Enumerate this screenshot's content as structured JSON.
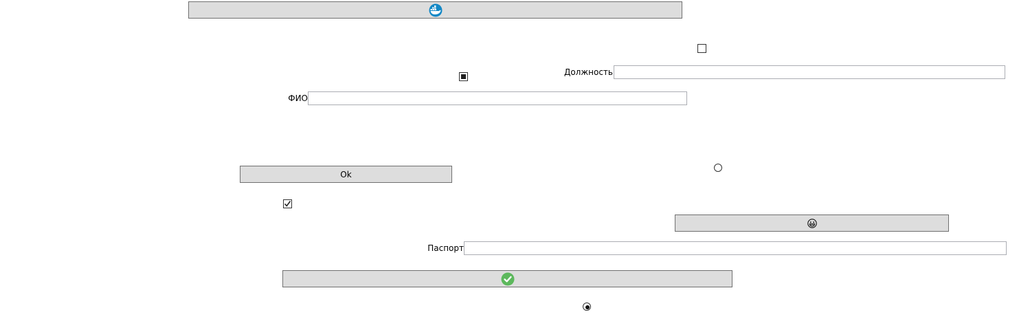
{
  "buttons": {
    "top_icon_button": {
      "icon": "docker-whale-icon",
      "icon_color": "#1488c6"
    },
    "ok_button": {
      "label": "Ok"
    },
    "emoji_button": {
      "icon": "grinning-face-icon"
    },
    "check_button": {
      "icon": "check-circle-icon",
      "icon_color": "#5cb85c"
    }
  },
  "fields": {
    "position": {
      "label": "Должность",
      "value": ""
    },
    "fio": {
      "label": "ФИО",
      "value": ""
    },
    "passport": {
      "label": "Паспорт",
      "value": ""
    }
  },
  "checkboxes": {
    "top_right": {
      "state": "unchecked"
    },
    "middle": {
      "state": "indeterminate"
    },
    "lower_left": {
      "state": "checked"
    }
  },
  "radios": {
    "right": {
      "state": "unselected"
    },
    "bottom": {
      "state": "selected"
    }
  },
  "colors": {
    "button_bg": "#dddddd",
    "button_border": "#707070",
    "textbox_border": "#abadb3"
  }
}
